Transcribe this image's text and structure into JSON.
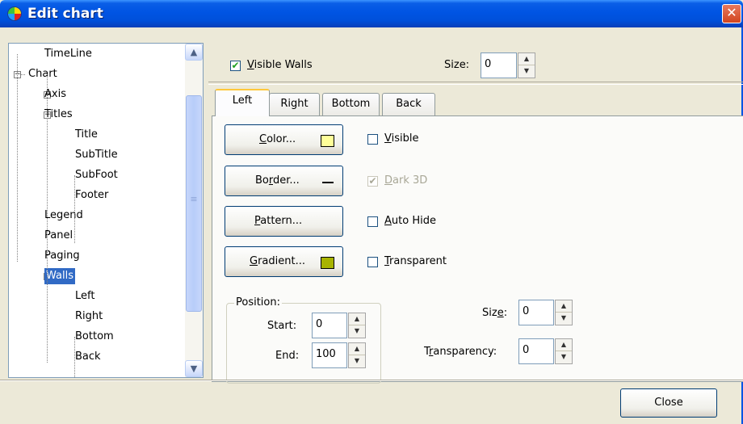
{
  "window": {
    "title": "Edit chart",
    "close_glyph": "✕"
  },
  "tree": {
    "items": [
      {
        "label": "TimeLine",
        "level": 1,
        "expander": ""
      },
      {
        "label": "Chart",
        "level": 0,
        "expander": "−"
      },
      {
        "label": "Axis",
        "level": 1,
        "expander": "+"
      },
      {
        "label": "Titles",
        "level": 1,
        "expander": "−"
      },
      {
        "label": "Title",
        "level": 2,
        "expander": ""
      },
      {
        "label": "SubTitle",
        "level": 2,
        "expander": ""
      },
      {
        "label": "SubFoot",
        "level": 2,
        "expander": ""
      },
      {
        "label": "Footer",
        "level": 2,
        "expander": ""
      },
      {
        "label": "Legend",
        "level": 1,
        "expander": ""
      },
      {
        "label": "Panel",
        "level": 1,
        "expander": ""
      },
      {
        "label": "Paging",
        "level": 1,
        "expander": ""
      },
      {
        "label": "Walls",
        "level": 1,
        "expander": "−",
        "selected": true
      },
      {
        "label": "Left",
        "level": 2,
        "expander": ""
      },
      {
        "label": "Right",
        "level": 2,
        "expander": ""
      },
      {
        "label": "Bottom",
        "level": 2,
        "expander": ""
      },
      {
        "label": "Back",
        "level": 2,
        "expander": ""
      }
    ],
    "scroll_up_glyph": "▲",
    "scroll_down_glyph": "▼",
    "scroll_grip": "≡"
  },
  "top": {
    "visible_walls": {
      "prefix": "",
      "underlined": "V",
      "rest": "isible Walls",
      "checked": true,
      "check_glyph": "✔"
    },
    "size_label": "Size:",
    "size_value": "0"
  },
  "tabs": [
    "Left",
    "Right",
    "Bottom",
    "Back"
  ],
  "active_tab": "Left",
  "buttons": {
    "color": {
      "underlined": "C",
      "rest": "olor...",
      "swatch": "#ffff99"
    },
    "border": {
      "pre": "Bo",
      "underlined": "r",
      "rest": "der...",
      "line_glyph": "—"
    },
    "pattern": {
      "underlined": "P",
      "rest": "attern..."
    },
    "gradient": {
      "underlined": "G",
      "rest": "radient...",
      "swatch": "#a8b400"
    }
  },
  "checks": {
    "visible": {
      "pre": "",
      "underlined": "",
      "first": "V",
      "rest": "isible",
      "checked": false
    },
    "dark3d": {
      "underlined": "D",
      "rest": "ark 3D",
      "checked": true,
      "disabled": true,
      "check_glyph": "✔"
    },
    "auto_hide": {
      "underlined": "A",
      "rest": "uto Hide",
      "checked": false
    },
    "transparent": {
      "underlined": "T",
      "rest": "ransparent",
      "checked": false
    }
  },
  "position": {
    "title": "Position:",
    "start_label": "Start:",
    "start_value": "0",
    "end_label": "End:",
    "end_value": "100"
  },
  "wall_size": {
    "pre": "Siz",
    "underlined": "e",
    "post": ":",
    "value": "0"
  },
  "transparency": {
    "pre": "T",
    "underlined": "r",
    "post": "ansparency:",
    "value": "0"
  },
  "spin": {
    "up": "▲",
    "down": "▼"
  },
  "footer": {
    "close_label": "Close"
  },
  "colors": {
    "titlebar": "#0054e3",
    "selection": "#316ac5",
    "window_bg": "#ece9d8"
  }
}
